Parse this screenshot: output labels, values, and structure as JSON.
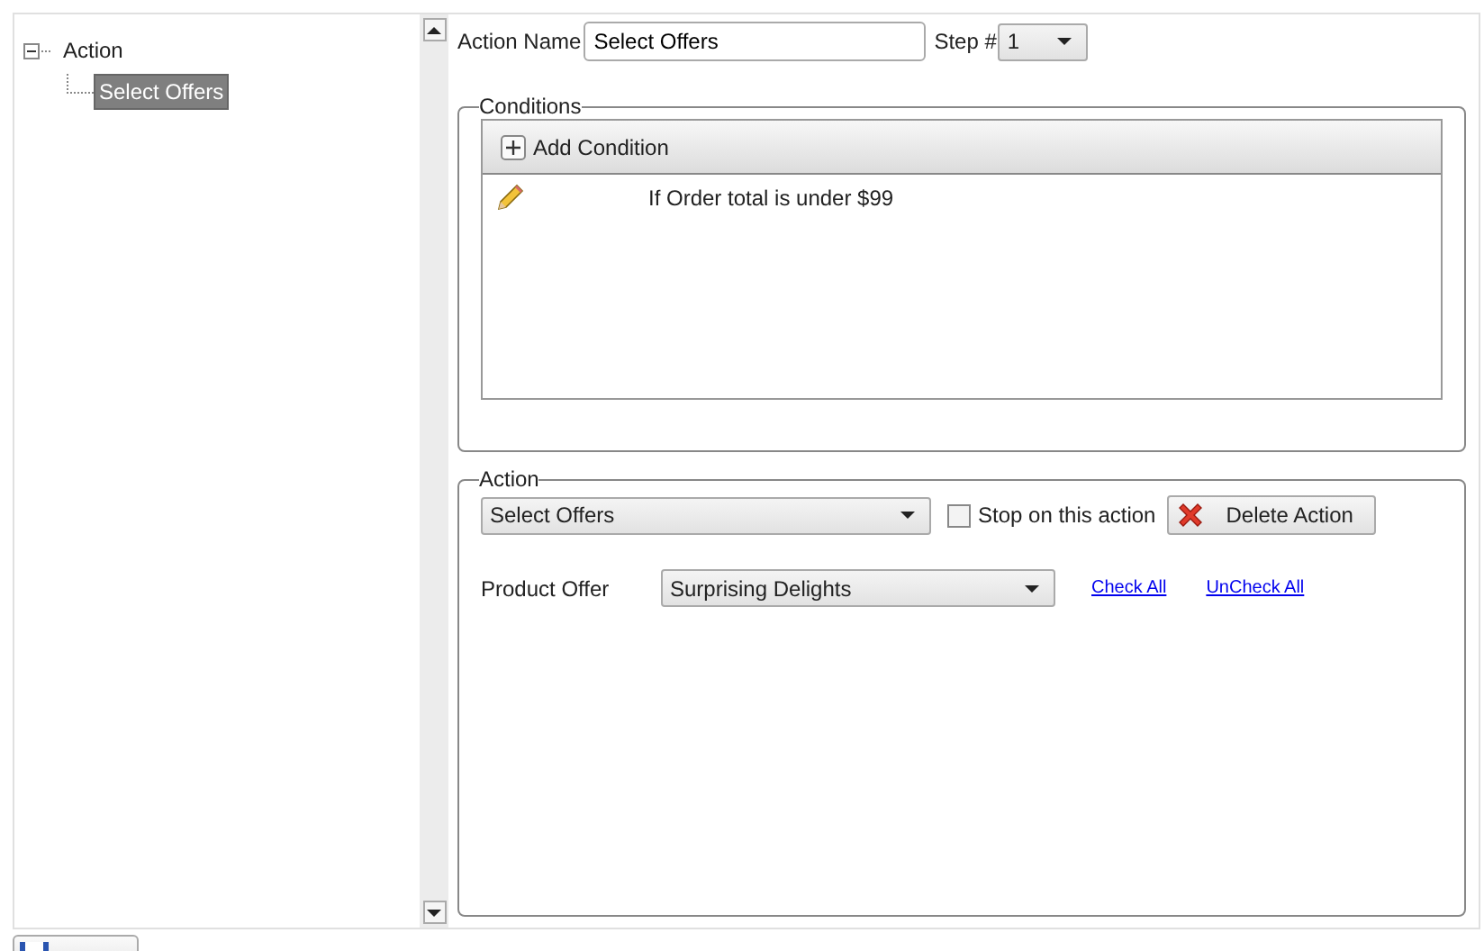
{
  "tree": [
    {
      "label": "Action",
      "expanded": true,
      "selected": false,
      "children": [
        {
          "label": "Select Offers",
          "selected": true
        }
      ]
    }
  ],
  "action_name": {
    "label": "Action Name",
    "value": "Select Offers"
  },
  "step": {
    "label": "Step #",
    "value": "1"
  },
  "conditions": {
    "legend": "Conditions",
    "add_button": "Add Condition",
    "rows": [
      {
        "text": "If Order total is under $99"
      }
    ]
  },
  "action": {
    "legend": "Action",
    "type_value": "Select Offers",
    "stop_checkbox": {
      "label": "Stop on this action",
      "checked": false
    },
    "delete_button": "Delete Action",
    "product_offer": {
      "label": "Product Offer",
      "value": "Surprising Delights"
    },
    "links": [
      "Check All",
      "UnCheck All"
    ]
  }
}
